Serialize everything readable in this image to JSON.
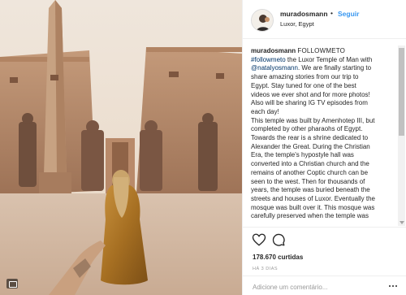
{
  "post": {
    "photo": {
      "alt": "Luxor Temple photo"
    }
  },
  "header": {
    "username": "muradosmann",
    "separator": "•",
    "follow_label": "Seguir",
    "location": "Luxor, Egypt"
  },
  "caption": {
    "username": "muradosmann",
    "title": "FOLLOWMETO",
    "hashtag": "#followmeto",
    "mention": "@natalyosmann",
    "line1_rest": " the Luxor Temple of Man with",
    "line2_rest": ". We are finally starting to",
    "lines": [
      "share amazing stories from our trip to",
      "Egypt. Stay tuned for one of the best",
      "videos we ever shot and for more photos!",
      "Also will be sharing IG TV episodes from",
      "each day!",
      "This temple was built by Amenhotep III, but",
      "completed by other pharaohs of Egypt.",
      "Towards the rear is a shrine dedicated to",
      "Alexander the Great. During the Christian",
      "Era, the temple's hypostyle hall was",
      "converted into a Christian church and the",
      "remains of another Coptic church can be",
      "seen to the west. Then for thousands of",
      "years, the temple was buried beneath the",
      "streets and houses of Luxor. Eventually the",
      "mosque was built over it. This mosque was",
      "carefully preserved when the temple was"
    ]
  },
  "actions": {
    "like_icon": "heart-icon",
    "comment_icon": "comment-icon",
    "likes_text": "178.670 curtidas",
    "time_text": "HÁ 3 DIAS"
  },
  "comment": {
    "placeholder": "Adicione um comentário..."
  },
  "colors": {
    "accent": "#3897f0",
    "link": "#003569",
    "muted": "#999999",
    "text": "#262626"
  }
}
